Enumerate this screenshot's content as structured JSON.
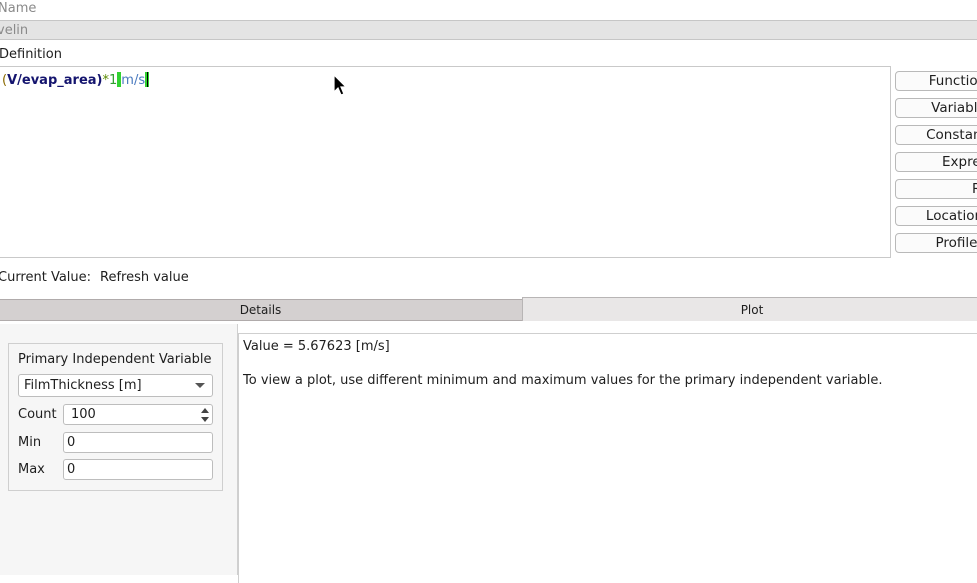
{
  "name": {
    "label": "Name",
    "value": "velin"
  },
  "definition": {
    "label": "Definition",
    "expression_tokens": {
      "open_paren": "(",
      "var1": "V",
      "slash": "/",
      "var2": "evap_area",
      "close_paren": ")",
      "op": "*",
      "num": "1",
      "unit": "m/s"
    }
  },
  "side_buttons": [
    "Functions",
    "Variables",
    "Constants",
    "Expressions",
    "Report Definitions",
    "Locations",
    "Profiles"
  ],
  "current_value": {
    "label": "Current Value:",
    "refresh_label": "Refresh value"
  },
  "tabs": {
    "details": "Details",
    "plot": "Plot",
    "active": "Plot"
  },
  "independent_variable": {
    "title": "Primary Independent Variable",
    "selected": "FilmThickness [m]",
    "count_label": "Count",
    "count_value": "100",
    "min_label": "Min",
    "min_value": "0",
    "max_label": "Max",
    "max_value": "0"
  },
  "output": {
    "value_text": "Value = 5.67623 [m/s]",
    "hint_text": "To view a plot, use different minimum and maximum values for the primary independent variable."
  },
  "colors": {
    "var_token": "#14146e",
    "number_token": "#2ea02e",
    "unit_token": "#4a7abf",
    "highlight": "#31d231"
  }
}
